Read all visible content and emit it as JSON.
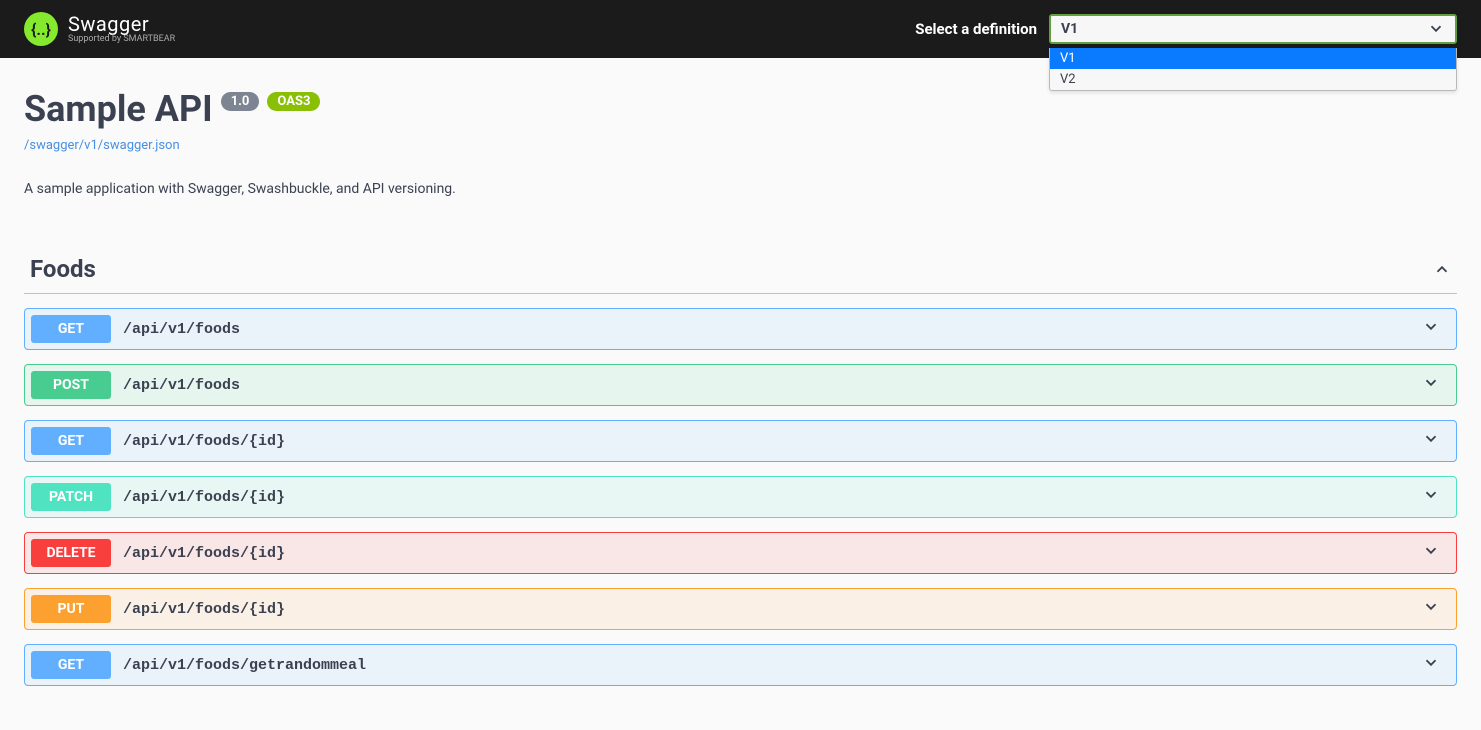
{
  "topbar": {
    "logo_main": "Swagger",
    "logo_sub": "Supported by SMARTBEAR",
    "def_label": "Select a definition",
    "def_selected": "V1",
    "def_options": [
      {
        "label": "V1",
        "highlighted": true
      },
      {
        "label": "V2",
        "highlighted": false
      }
    ]
  },
  "info": {
    "title": "Sample API",
    "version_badge": "1.0",
    "oas_badge": "OAS3",
    "spec_link": "/swagger/v1/swagger.json",
    "description": "A sample application with Swagger, Swashbuckle, and API versioning."
  },
  "tag": {
    "name": "Foods"
  },
  "operations": [
    {
      "method": "GET",
      "path": "/api/v1/foods",
      "op_class": "op-get",
      "m_class": "m-get"
    },
    {
      "method": "POST",
      "path": "/api/v1/foods",
      "op_class": "op-post",
      "m_class": "m-post"
    },
    {
      "method": "GET",
      "path": "/api/v1/foods/{id}",
      "op_class": "op-get",
      "m_class": "m-get"
    },
    {
      "method": "PATCH",
      "path": "/api/v1/foods/{id}",
      "op_class": "op-patch",
      "m_class": "m-patch"
    },
    {
      "method": "DELETE",
      "path": "/api/v1/foods/{id}",
      "op_class": "op-delete",
      "m_class": "m-delete"
    },
    {
      "method": "PUT",
      "path": "/api/v1/foods/{id}",
      "op_class": "op-put",
      "m_class": "m-put"
    },
    {
      "method": "GET",
      "path": "/api/v1/foods/getrandommeal",
      "op_class": "op-get",
      "m_class": "m-get"
    }
  ]
}
